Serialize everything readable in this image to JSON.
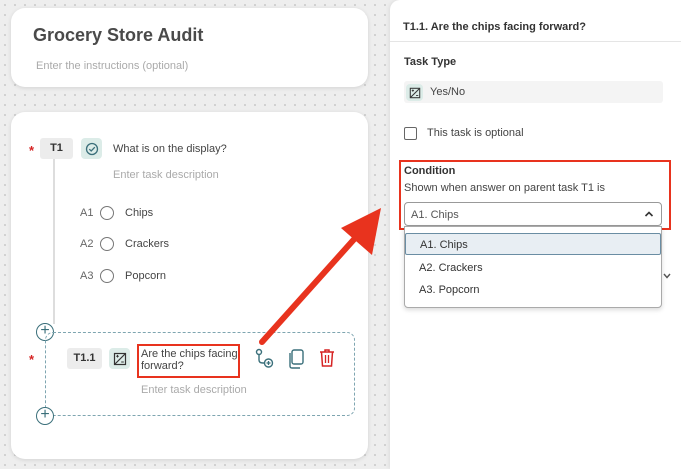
{
  "form": {
    "title": "Grocery Store Audit",
    "instructions_placeholder": "Enter the instructions (optional)"
  },
  "task_t1": {
    "required_marker": "*",
    "id": "T1",
    "question": "What is on the display?",
    "description_placeholder": "Enter task description",
    "answers": [
      {
        "code": "A1",
        "label": "Chips"
      },
      {
        "code": "A2",
        "label": "Crackers"
      },
      {
        "code": "A3",
        "label": "Popcorn"
      }
    ]
  },
  "task_t11": {
    "required_marker": "*",
    "id": "T1.1",
    "question_line1": "Are the chips facing",
    "question_line2": "forward?",
    "description_placeholder": "Enter task description"
  },
  "panel": {
    "header": "T1.1. Are the chips facing forward?",
    "task_type_label": "Task Type",
    "task_type_value": "Yes/No",
    "optional_label": "This task is optional",
    "condition_label": "Condition",
    "condition_text": "Shown when answer on parent task T1 is",
    "selected": "A1. Chips",
    "options": [
      "A1. Chips",
      "A2. Crackers",
      "A3. Popcorn"
    ]
  },
  "colors": {
    "highlight": "#e8331e",
    "accent": "#3a6f7a",
    "delete": "#d62424"
  }
}
